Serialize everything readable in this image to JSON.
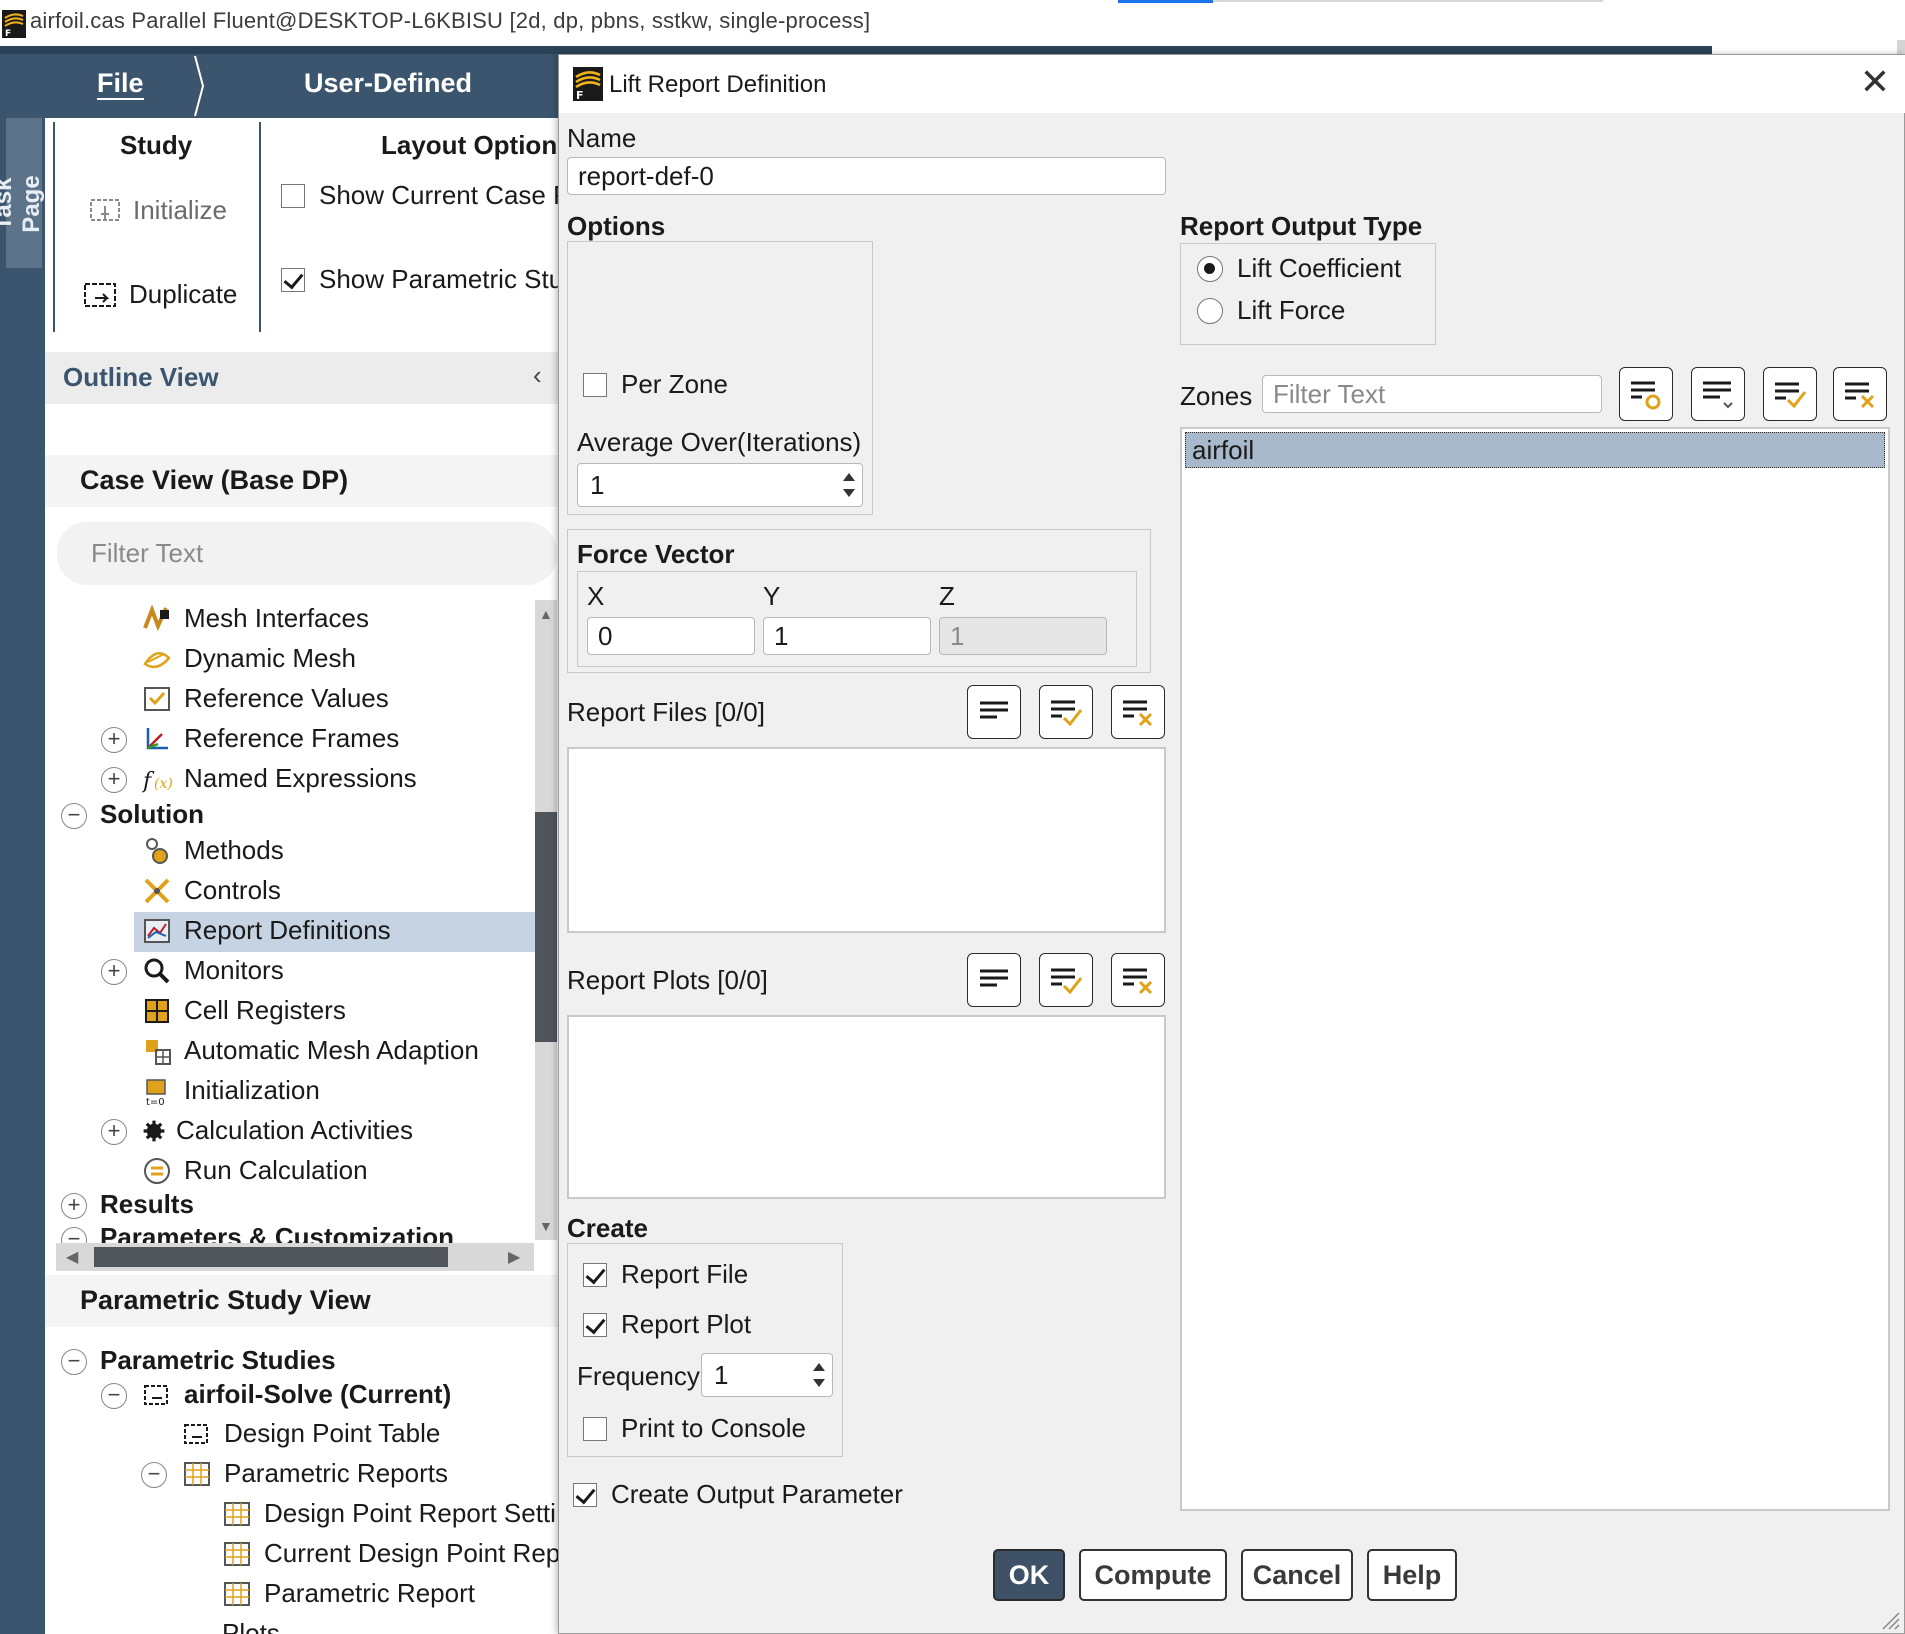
{
  "window": {
    "title": "airfoil.cas Parallel Fluent@DESKTOP-L6KBISU  [2d, dp, pbns, sstkw, single-process]"
  },
  "ribbon": {
    "tabs": [
      "File",
      "User-Defined"
    ],
    "study_group": "Study",
    "initialize_label": "Initialize",
    "duplicate_label": "Duplicate",
    "layout_group": "Layout Option",
    "show_current_case": "Show Current Case P",
    "show_parametric": "Show Parametric Stu",
    "show_current_case_checked": false,
    "show_parametric_checked": true
  },
  "task_page": {
    "label": "Task Page"
  },
  "outline": {
    "header": "Outline View",
    "case_view": "Case View (Base DP)",
    "filter_placeholder": "Filter Text",
    "tree": [
      {
        "label": "Mesh Interfaces",
        "icon": "mesh-interfaces-icon"
      },
      {
        "label": "Dynamic Mesh",
        "icon": "dynamic-mesh-icon"
      },
      {
        "label": "Reference Values",
        "icon": "reference-values-icon"
      },
      {
        "label": "Reference Frames",
        "icon": "reference-frames-icon"
      },
      {
        "label": "Named Expressions",
        "icon": "named-expressions-icon"
      },
      {
        "label": "Solution",
        "icon": ""
      },
      {
        "label": "Methods",
        "icon": "methods-icon"
      },
      {
        "label": "Controls",
        "icon": "controls-icon"
      },
      {
        "label": "Report Definitions",
        "icon": "report-definitions-icon"
      },
      {
        "label": "Monitors",
        "icon": "monitors-icon"
      },
      {
        "label": "Cell Registers",
        "icon": "cell-registers-icon"
      },
      {
        "label": "Automatic Mesh Adaption",
        "icon": "mesh-adaption-icon"
      },
      {
        "label": "Initialization",
        "icon": "initialization-icon"
      },
      {
        "label": "Calculation Activities",
        "icon": "calculation-activities-icon"
      },
      {
        "label": "Run Calculation",
        "icon": "run-calculation-icon"
      },
      {
        "label": "Results",
        "icon": ""
      },
      {
        "label": "Parameters & Customization",
        "icon": ""
      }
    ],
    "selected": "Report Definitions",
    "param_view": "Parametric Study View",
    "param_tree": [
      {
        "label": "Parametric Studies"
      },
      {
        "label": "airfoil-Solve (Current)"
      },
      {
        "label": "Design Point Table"
      },
      {
        "label": "Parametric Reports"
      },
      {
        "label": "Design Point Report Setti"
      },
      {
        "label": "Current Design Point Rep"
      },
      {
        "label": "Parametric Report"
      },
      {
        "label": "Plots"
      }
    ]
  },
  "dialog": {
    "title": "Lift Report Definition",
    "name_label": "Name",
    "name_value": "report-def-0",
    "options_label": "Options",
    "per_zone_label": "Per Zone",
    "per_zone_checked": false,
    "average_over_label": "Average Over(Iterations)",
    "average_over_value": "1",
    "force_vector_label": "Force Vector",
    "x_label": "X",
    "y_label": "Y",
    "z_label": "Z",
    "x_value": "0",
    "y_value": "1",
    "z_value": "1",
    "report_files_label": "Report Files  [0/0]",
    "report_plots_label": "Report Plots  [0/0]",
    "create_label": "Create",
    "report_file_label": "Report File",
    "report_file_checked": true,
    "report_plot_label": "Report Plot",
    "report_plot_checked": true,
    "frequency_label": "Frequency",
    "frequency_value": "1",
    "print_console_label": "Print to Console",
    "print_console_checked": false,
    "create_output_param_label": "Create Output Parameter",
    "create_output_param_checked": true,
    "output_type_label": "Report Output Type",
    "output_types": [
      "Lift Coefficient",
      "Lift Force"
    ],
    "output_type_selected": "Lift Coefficient",
    "zones_label": "Zones",
    "zones_filter_placeholder": "Filter Text",
    "zones": [
      "airfoil"
    ],
    "buttons": {
      "ok": "OK",
      "compute": "Compute",
      "cancel": "Cancel",
      "help": "Help"
    }
  },
  "colors": {
    "ribbon": "#3b556f",
    "selection": "#c5d3e2",
    "zone_selected": "#a7b9cb",
    "primary_button": "#3f5166"
  }
}
